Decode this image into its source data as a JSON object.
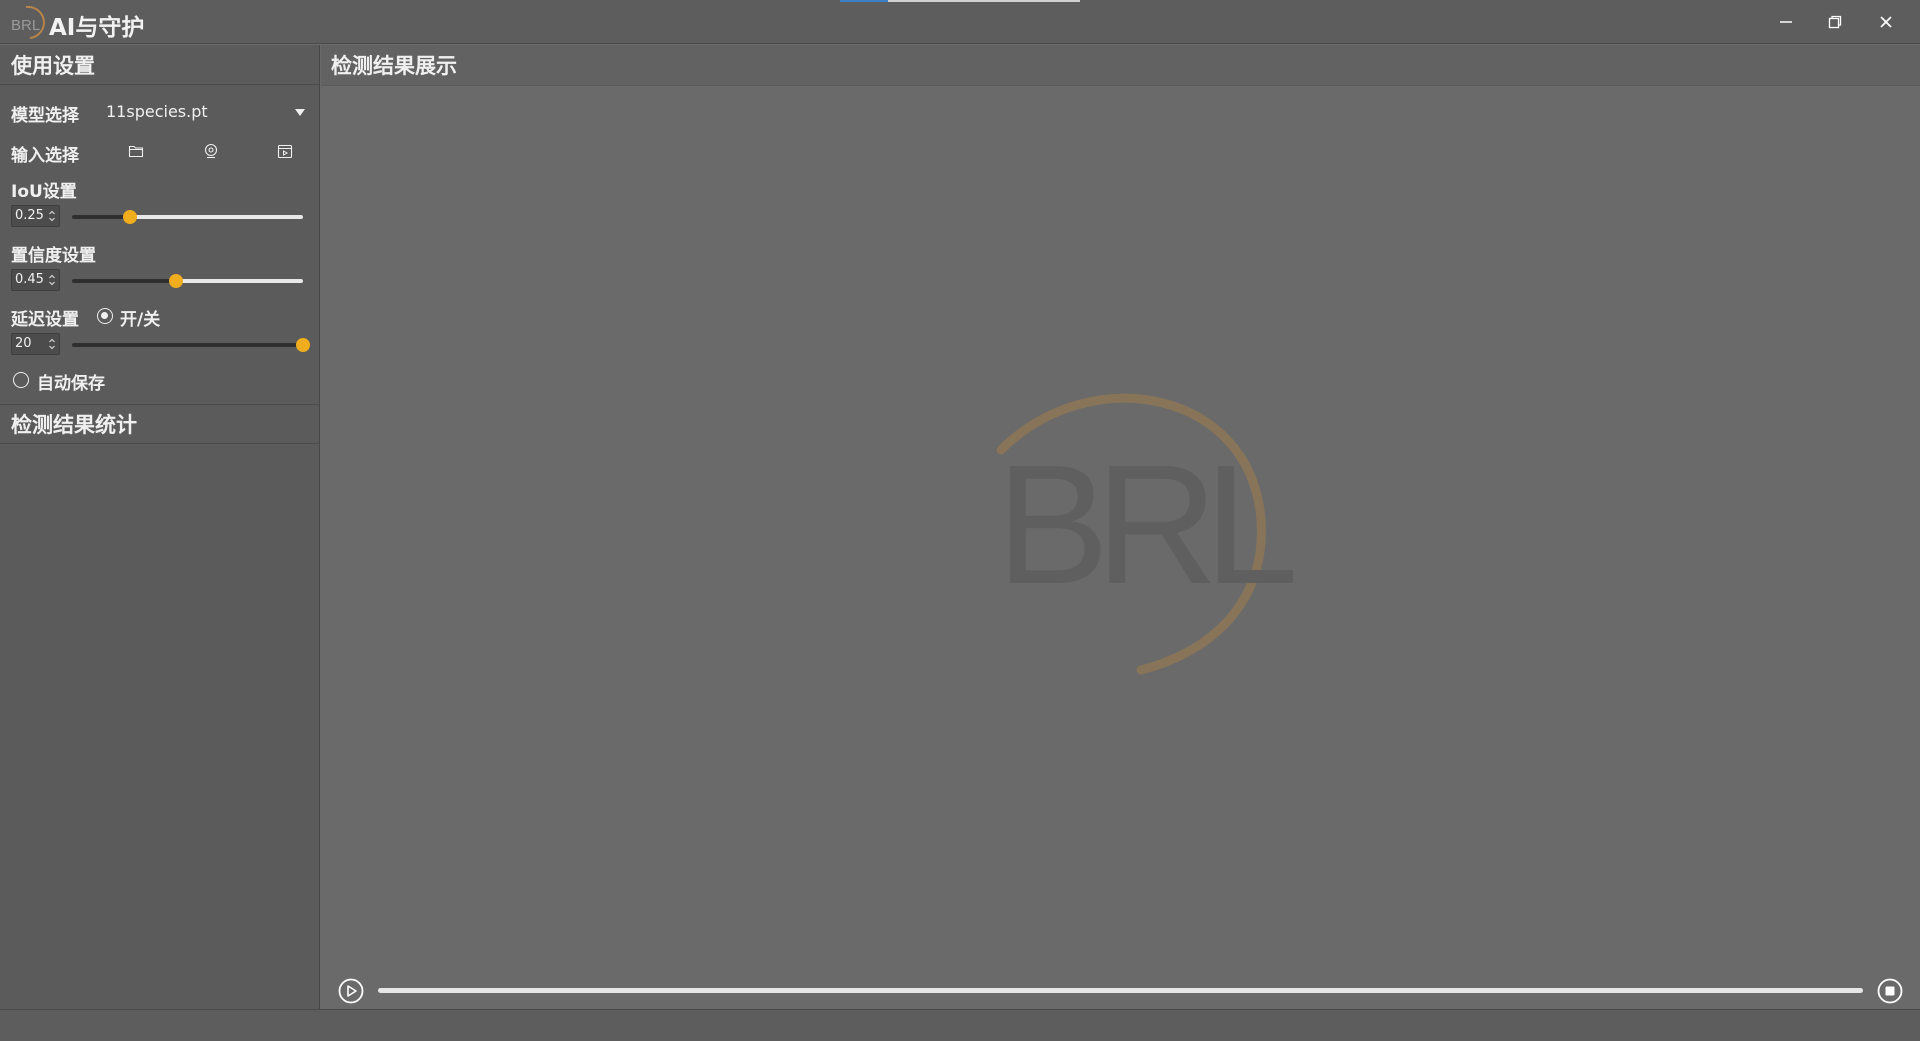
{
  "app": {
    "title": "AI与守护",
    "logo_text": "BRL"
  },
  "window_controls": {
    "minimize_icon": "minimize-icon",
    "restore_icon": "restore-icon",
    "close_icon": "close-icon"
  },
  "sidebar": {
    "settings_title": "使用设置",
    "model": {
      "label": "模型选择",
      "selected": "11species.pt"
    },
    "input": {
      "label": "输入选择",
      "icons": [
        "folder-icon",
        "webcam-icon",
        "video-icon"
      ]
    },
    "iou": {
      "label": "IoU设置",
      "value": "0.25",
      "slider_fraction": 0.25
    },
    "confidence": {
      "label": "置信度设置",
      "value": "0.45",
      "slider_fraction": 0.45
    },
    "delay": {
      "label": "延迟设置",
      "toggle_label": "开/关",
      "toggle_checked": true,
      "value": "20",
      "slider_fraction": 1.0
    },
    "autosave": {
      "label": "自动保存",
      "checked": false
    },
    "stats_title": "检测结果统计"
  },
  "main": {
    "title": "检测结果展示",
    "watermark_text": "BRL",
    "progress_fraction": 0.0
  },
  "colors": {
    "accent": "#f0ad1e",
    "watermark_arc": "#9c7a4a"
  }
}
